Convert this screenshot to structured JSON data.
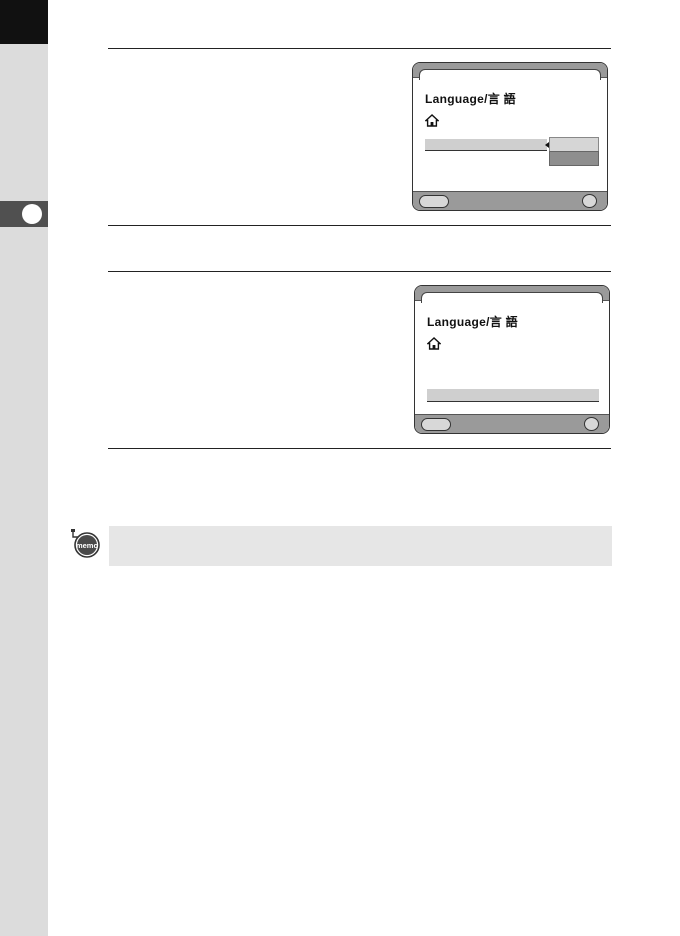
{
  "screen_1": {
    "title": "Language/言 語"
  },
  "screen_2": {
    "title": "Language/言 語"
  },
  "icons": {
    "home": "home-icon",
    "memo": "memo-icon",
    "chapter_marker": "chapter-circle-icon"
  },
  "memo": {
    "icon_text": "memo"
  },
  "colors": {
    "side_strip": "#dcdcdc",
    "chapter_tab": "#505050",
    "memo_background": "#e6e6e6",
    "screen_bars": "#9a9a9a"
  }
}
